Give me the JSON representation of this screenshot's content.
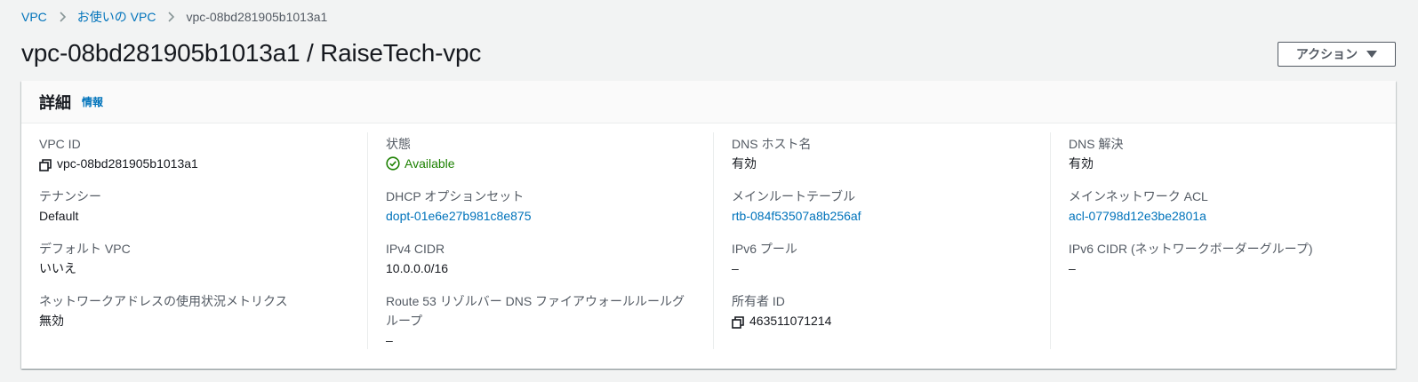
{
  "breadcrumb": {
    "items": [
      "VPC",
      "お使いの VPC"
    ],
    "current": "vpc-08bd281905b1013a1"
  },
  "page": {
    "title": "vpc-08bd281905b1013a1 / RaiseTech-vpc",
    "actions_label": "アクション"
  },
  "panel": {
    "title": "詳細",
    "info_label": "情報"
  },
  "details": {
    "vpc_id": {
      "label": "VPC ID",
      "value": "vpc-08bd281905b1013a1"
    },
    "tenancy": {
      "label": "テナンシー",
      "value": "Default"
    },
    "default_vpc": {
      "label": "デフォルト VPC",
      "value": "いいえ"
    },
    "net_metrics": {
      "label": "ネットワークアドレスの使用状況メトリクス",
      "value": "無効"
    },
    "state": {
      "label": "状態",
      "value": "Available"
    },
    "dhcp": {
      "label": "DHCP オプションセット",
      "value": "dopt-01e6e27b981c8e875"
    },
    "ipv4_cidr": {
      "label": "IPv4 CIDR",
      "value": "10.0.0.0/16"
    },
    "route53": {
      "label": "Route 53 リゾルバー DNS ファイアウォールルールグループ",
      "value": "–"
    },
    "dns_hostnames": {
      "label": "DNS ホスト名",
      "value": "有効"
    },
    "main_route_table": {
      "label": "メインルートテーブル",
      "value": "rtb-084f53507a8b256af"
    },
    "ipv6_pool": {
      "label": "IPv6 プール",
      "value": "–"
    },
    "owner_id": {
      "label": "所有者 ID",
      "value": "463511071214"
    },
    "dns_resolution": {
      "label": "DNS 解決",
      "value": "有効"
    },
    "main_acl": {
      "label": "メインネットワーク ACL",
      "value": "acl-07798d12e3be2801a"
    },
    "ipv6_cidr": {
      "label": "IPv6 CIDR (ネットワークボーダーグループ)",
      "value": "–"
    }
  },
  "colors": {
    "link": "#0073bb",
    "status_ok": "#1d8102",
    "label": "#545b64"
  }
}
